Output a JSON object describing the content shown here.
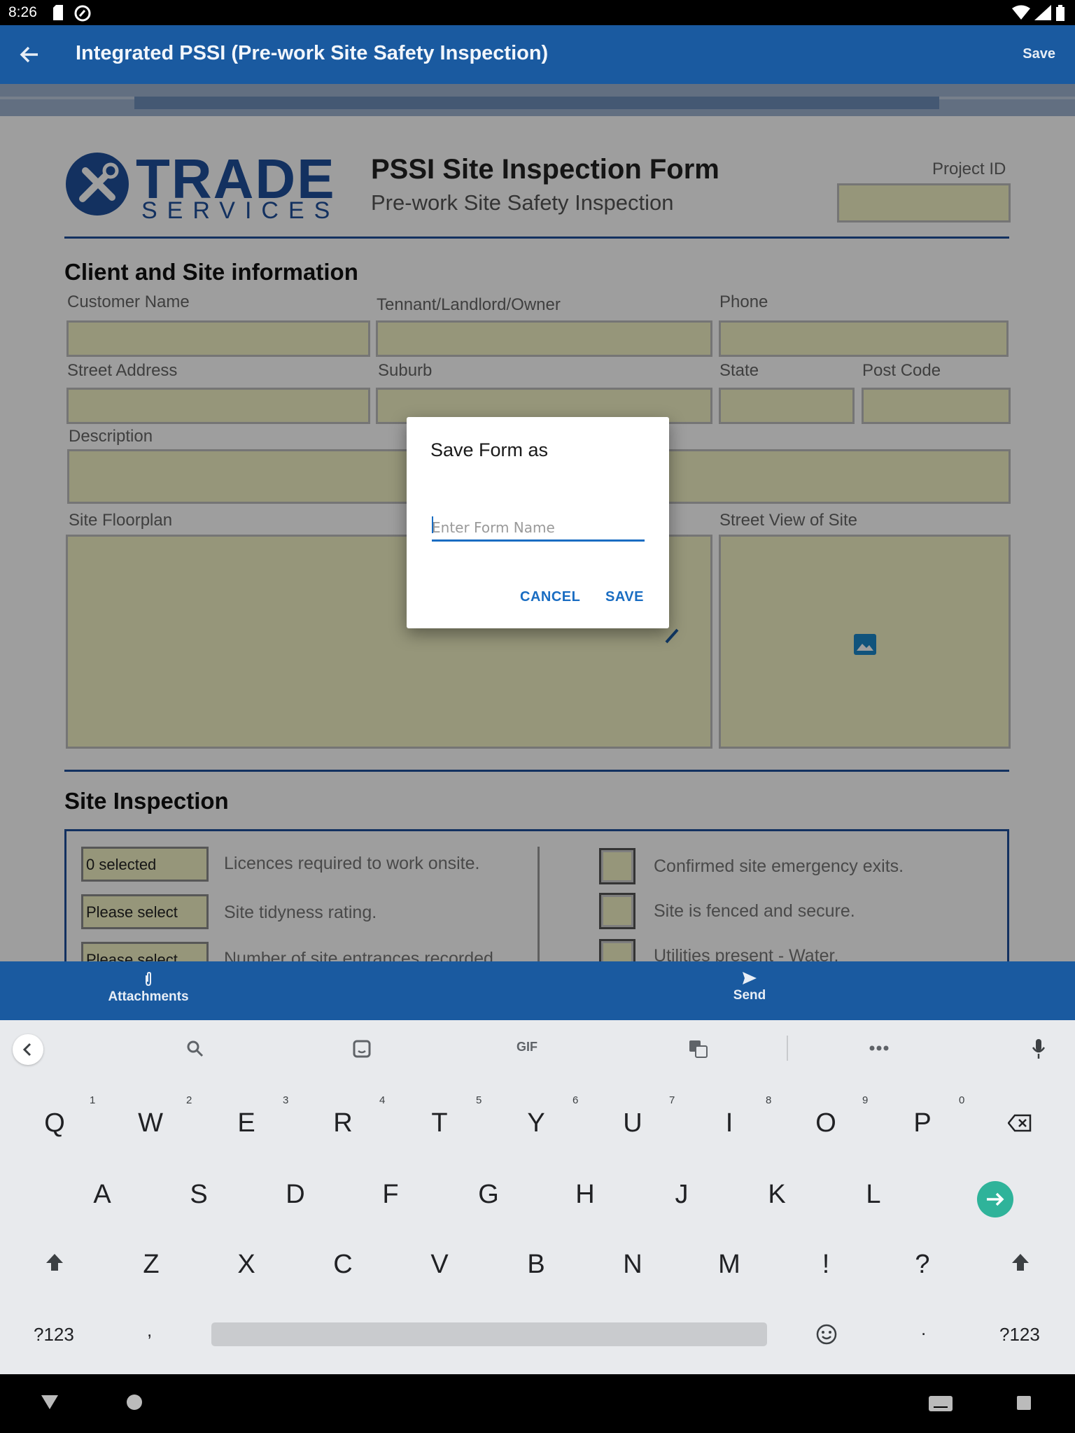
{
  "status_bar": {
    "time": "8:26"
  },
  "app_bar": {
    "title": "Integrated PSSI (Pre-work Site Safety Inspection)",
    "save_label": "Save"
  },
  "form": {
    "logo_word": "TRADE",
    "logo_sub": "SERVICES",
    "title": "PSSI Site Inspection Form",
    "subtitle": "Pre-work Site Safety Inspection",
    "project_id_label": "Project ID",
    "client_section_title": "Client and Site information",
    "labels": {
      "customer_name": "Customer Name",
      "tenant": "Tennant/Landlord/Owner",
      "phone": "Phone",
      "street_address": "Street Address",
      "suburb": "Suburb",
      "state": "State",
      "post_code": "Post Code",
      "description": "Description",
      "site_floorplan": "Site Floorplan",
      "street_view": "Street View of Site"
    },
    "inspection_section_title": "Site Inspection",
    "selects": [
      {
        "value": "0 selected",
        "label": "Licences required to work onsite."
      },
      {
        "value": "Please select",
        "label": "Site tidyness rating."
      },
      {
        "value": "Please select",
        "label": "Number of site entrances recorded."
      }
    ],
    "checks": [
      {
        "label": "Confirmed site emergency exits."
      },
      {
        "label": "Site is fenced and secure."
      },
      {
        "label": "Utilities present - Water."
      }
    ]
  },
  "bottom_bar": {
    "attachments_label": "Attachments",
    "send_label": "Send"
  },
  "dialog": {
    "title": "Save Form as",
    "input_placeholder": "Enter Form Name",
    "input_value": "",
    "cancel_label": "CANCEL",
    "save_label": "SAVE"
  },
  "keyboard": {
    "gif_label": "GIF",
    "row1": [
      "Q",
      "W",
      "E",
      "R",
      "T",
      "Y",
      "U",
      "I",
      "O",
      "P"
    ],
    "row1_hints": [
      "1",
      "2",
      "3",
      "4",
      "5",
      "6",
      "7",
      "8",
      "9",
      "0"
    ],
    "row2": [
      "A",
      "S",
      "D",
      "F",
      "G",
      "H",
      "J",
      "K",
      "L"
    ],
    "row3": [
      "Z",
      "X",
      "C",
      "V",
      "B",
      "N",
      "M",
      "!",
      "?"
    ],
    "symbols_label": "?123",
    "comma": ",",
    "period": "."
  },
  "colors": {
    "app_bar": "#1a5aa0",
    "accent": "#1a6dc2",
    "field_fill": "#f3f3c6",
    "enter_key": "#2fb39a"
  }
}
